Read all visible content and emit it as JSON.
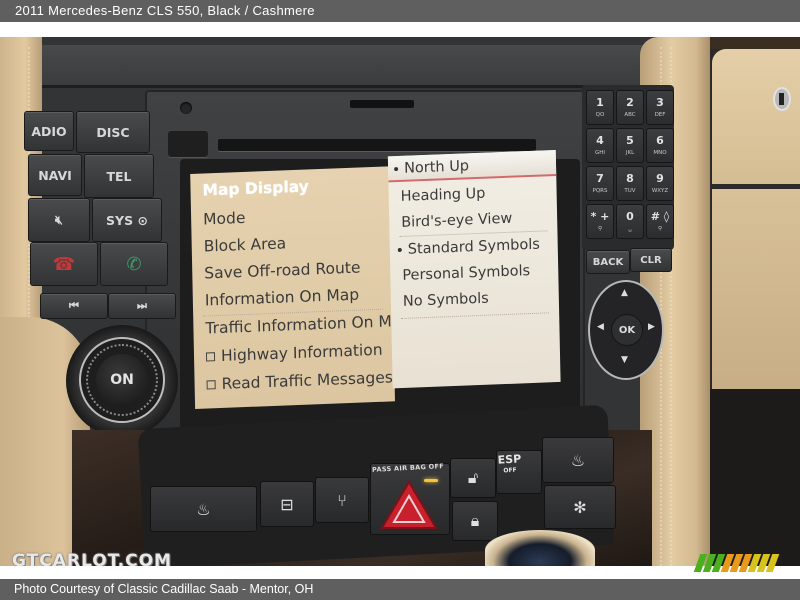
{
  "header": {
    "title": "2011 Mercedes-Benz CLS 550,  Black / Cashmere"
  },
  "footer": {
    "credit": "Photo Courtesy of Classic Cadillac Saab - Mentor, OH"
  },
  "watermark": {
    "text": "GTCARLOT.COM",
    "logo_colors": [
      "#4caf1e",
      "#e89a1a",
      "#d8c21c"
    ]
  },
  "console": {
    "left_buttons": [
      "ADIO",
      "DISC",
      "NAVI",
      "TEL",
      "mute-icon",
      "SYS",
      "end-call-icon",
      "call-icon",
      "skip-back-icon",
      "skip-forward-icon"
    ],
    "left_labels": {
      "radio": "ADIO",
      "disc": "DISC",
      "navi": "NAVI",
      "tel": "TEL",
      "sys": "SYS ⊙",
      "prev": "⏮",
      "next": "⏭",
      "mute": "🔇︎",
      "end_call": "☎",
      "call": "✆"
    },
    "knob_label": "ON",
    "eject_label": "●))",
    "keypad": [
      {
        "num": "1",
        "sub": "QO"
      },
      {
        "num": "2",
        "sub": "ABC"
      },
      {
        "num": "3",
        "sub": "DEF"
      },
      {
        "num": "4",
        "sub": "GHI"
      },
      {
        "num": "5",
        "sub": "JKL"
      },
      {
        "num": "6",
        "sub": "MNO"
      },
      {
        "num": "7",
        "sub": "PQRS"
      },
      {
        "num": "8",
        "sub": "TUV"
      },
      {
        "num": "9",
        "sub": "WXYZ"
      },
      {
        "num": "* +",
        "sub": "⚲"
      },
      {
        "num": "0",
        "sub": "␣"
      },
      {
        "num": "# ◊",
        "sub": "⚲"
      }
    ],
    "back_label": "BACK",
    "clr_label": "CLR",
    "ok_label": "OK",
    "switches": {
      "airbag_label": "PASS AIR BAG OFF",
      "esp_label": "ESP",
      "esp_sub": "OFF",
      "airbag_led_color": "#f5c43a",
      "hazard_color": "#c8202c"
    }
  },
  "screen": {
    "left_menu": [
      {
        "label": "Map Display",
        "selected": true,
        "checkbox": false
      },
      {
        "label": "Mode",
        "selected": false,
        "checkbox": false
      },
      {
        "label": "Block Area",
        "selected": false,
        "checkbox": false
      },
      {
        "label": "Save Off-road Route",
        "selected": false,
        "checkbox": false
      },
      {
        "label": "Information On Map",
        "selected": false,
        "checkbox": false
      },
      {
        "label": "Traffic Information On M",
        "selected": false,
        "checkbox": false
      },
      {
        "label": "Highway Information",
        "selected": false,
        "checkbox": true
      },
      {
        "label": "Read Traffic Messages A",
        "selected": false,
        "checkbox": true
      }
    ],
    "right_menu": [
      {
        "label": "North Up",
        "active": true,
        "highlighted": true
      },
      {
        "label": "Heading Up",
        "active": false,
        "highlighted": false
      },
      {
        "label": "Bird's-eye View",
        "active": false,
        "highlighted": false
      },
      {
        "label": "Standard Symbols",
        "active": true,
        "highlighted": false
      },
      {
        "label": "Personal Symbols",
        "active": false,
        "highlighted": false
      },
      {
        "label": "No Symbols",
        "active": false,
        "highlighted": false
      }
    ],
    "highlight_underline_color": "#d36a6a"
  }
}
